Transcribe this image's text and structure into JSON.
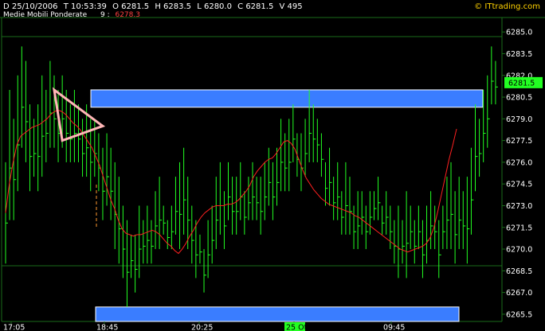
{
  "header": {
    "date": "D 25/10/2006",
    "time": "T 10:53:39",
    "open": "O 6281.5",
    "high": "H 6283.5",
    "low": "L 6280.0",
    "close": "C 6281.5",
    "volume": "V 495",
    "indicator_name": "Medie Mobili Ponderate",
    "indicator_period": "9 :",
    "indicator_value": "6278.3",
    "brand": "© ITtrading.com"
  },
  "colors": {
    "background": "#000000",
    "bars": "#22ff22",
    "moving_average": "#ff2020",
    "zones": "#3a7dff",
    "zone_border": "#ffffff",
    "triangle": "#ffb6b6",
    "grid": "#1a6b1a",
    "price_tag": "#22ff22",
    "indicator": "#ff4040",
    "brand": "#ffd200"
  },
  "chart_data": {
    "type": "bar",
    "subtype": "ohlc",
    "ylim": [
      6265.0,
      6286.0
    ],
    "y_ticks": [
      "6285.0",
      "6283.5",
      "6282.0",
      "6280.5",
      "6279.0",
      "6277.5",
      "6276.0",
      "6274.5",
      "6273.0",
      "6271.5",
      "6270.0",
      "6268.5",
      "6267.0",
      "6265.5"
    ],
    "x_ticks": [
      "17:05",
      "18:45",
      "20:25",
      "25 Ott",
      "09:45"
    ],
    "current_price": "6281.5",
    "bars": [
      [
        6276,
        6269
      ],
      [
        6281,
        6272
      ],
      [
        6279,
        6272
      ],
      [
        6282,
        6274
      ],
      [
        6284,
        6277
      ],
      [
        6283,
        6276
      ],
      [
        6280,
        6274
      ],
      [
        6279,
        6275
      ],
      [
        6280,
        6274
      ],
      [
        6282,
        6275
      ],
      [
        6281,
        6276
      ],
      [
        6283,
        6277
      ],
      [
        6282,
        6277
      ],
      [
        6281,
        6276
      ],
      [
        6282,
        6277
      ],
      [
        6281,
        6276
      ],
      [
        6280,
        6276
      ],
      [
        6281,
        6276
      ],
      [
        6280,
        6276
      ],
      [
        6279,
        6275
      ],
      [
        6280,
        6275
      ],
      [
        6279,
        6274
      ],
      [
        6279,
        6275
      ],
      [
        6278,
        6274
      ],
      [
        6277,
        6272
      ],
      [
        6278,
        6273
      ],
      [
        6277,
        6272
      ],
      [
        6276,
        6270
      ],
      [
        6275,
        6269
      ],
      [
        6273,
        6268
      ],
      [
        6272,
        6266
      ],
      [
        6271,
        6268
      ],
      [
        6271,
        6267
      ],
      [
        6273,
        6268
      ],
      [
        6272,
        6269
      ],
      [
        6273,
        6269
      ],
      [
        6272,
        6269
      ],
      [
        6274,
        6270
      ],
      [
        6275,
        6270
      ],
      [
        6273,
        6271
      ],
      [
        6272,
        6270
      ],
      [
        6273,
        6270
      ],
      [
        6275,
        6271
      ],
      [
        6276,
        6270
      ],
      [
        6277,
        6271
      ],
      [
        6275,
        6270
      ],
      [
        6273,
        6269
      ],
      [
        6272,
        6268
      ],
      [
        6271,
        6269
      ],
      [
        6270,
        6267
      ],
      [
        6272,
        6268
      ],
      [
        6273,
        6269
      ],
      [
        6275,
        6270
      ],
      [
        6276,
        6271
      ],
      [
        6274,
        6270
      ],
      [
        6276,
        6272
      ],
      [
        6275,
        6271
      ],
      [
        6275,
        6271
      ],
      [
        6276,
        6272
      ],
      [
        6274,
        6271
      ],
      [
        6275,
        6272
      ],
      [
        6276,
        6272
      ],
      [
        6275,
        6272
      ],
      [
        6275,
        6271
      ],
      [
        6276,
        6272
      ],
      [
        6277,
        6273
      ],
      [
        6276,
        6272
      ],
      [
        6277,
        6273
      ],
      [
        6279,
        6274
      ],
      [
        6278,
        6274
      ],
      [
        6279,
        6274
      ],
      [
        6280,
        6276
      ],
      [
        6278,
        6275
      ],
      [
        6278,
        6274
      ],
      [
        6279,
        6275
      ],
      [
        6281,
        6276
      ],
      [
        6280,
        6276
      ],
      [
        6279,
        6276
      ],
      [
        6278,
        6275
      ],
      [
        6276,
        6273
      ],
      [
        6277,
        6273
      ],
      [
        6275,
        6272
      ],
      [
        6276,
        6272
      ],
      [
        6274,
        6271
      ],
      [
        6276,
        6271
      ],
      [
        6275,
        6271
      ],
      [
        6273,
        6270
      ],
      [
        6274,
        6270
      ],
      [
        6274,
        6271
      ],
      [
        6273,
        6270
      ],
      [
        6274,
        6271
      ],
      [
        6274,
        6272
      ],
      [
        6275,
        6272
      ],
      [
        6273,
        6271
      ],
      [
        6274,
        6271
      ],
      [
        6273,
        6270
      ],
      [
        6272,
        6269
      ],
      [
        6273,
        6268
      ],
      [
        6272,
        6269
      ],
      [
        6274,
        6268
      ],
      [
        6273,
        6270
      ],
      [
        6272,
        6269
      ],
      [
        6273,
        6270
      ],
      [
        6272,
        6268
      ],
      [
        6273,
        6269
      ],
      [
        6274,
        6270
      ],
      [
        6273,
        6270
      ],
      [
        6272,
        6268
      ],
      [
        6273,
        6270
      ],
      [
        6275,
        6270
      ],
      [
        6276,
        6270
      ],
      [
        6274,
        6269
      ],
      [
        6275,
        6270
      ],
      [
        6274,
        6270
      ],
      [
        6275,
        6269
      ],
      [
        6277,
        6271
      ],
      [
        6280,
        6274
      ],
      [
        6279,
        6275
      ],
      [
        6281,
        6276
      ],
      [
        6282,
        6277
      ],
      [
        6284,
        6280
      ],
      [
        6283,
        6280
      ]
    ],
    "moving_average": [
      6272.5,
      6274.5,
      6276.0,
      6277.2,
      6277.8,
      6278.0,
      6278.2,
      6278.4,
      6278.5,
      6278.6,
      6278.8,
      6279.0,
      6279.3,
      6279.5,
      6279.6,
      6279.5,
      6279.3,
      6279.0,
      6278.7,
      6278.5,
      6278.2,
      6277.8,
      6277.4,
      6277.0,
      6276.4,
      6275.8,
      6275.0,
      6274.2,
      6273.4,
      6272.8,
      6272.0,
      6271.4,
      6271.1,
      6271.0,
      6270.9,
      6271.0,
      6271.0,
      6271.1,
      6271.2,
      6271.3,
      6271.2,
      6271.0,
      6270.7,
      6270.4,
      6270.2,
      6269.9,
      6269.7,
      6270.0,
      6270.4,
      6270.9,
      6271.3,
      6271.8,
      6272.2,
      6272.5,
      6272.7,
      6272.9,
      6273.0,
      6273.0,
      6273.0,
      6273.1,
      6273.1,
      6273.2,
      6273.4,
      6273.7,
      6274.0,
      6274.4,
      6275.0,
      6275.4,
      6275.7,
      6276.0,
      6276.2,
      6276.3,
      6276.6,
      6277.0,
      6277.4,
      6277.5,
      6277.3,
      6276.9,
      6276.2,
      6275.5,
      6274.9,
      6274.5,
      6274.1,
      6273.8,
      6273.5,
      6273.3,
      6273.1,
      6273.0,
      6272.9,
      6272.8,
      6272.7,
      6272.6,
      6272.5,
      6272.3,
      6272.2,
      6272.0,
      6271.8,
      6271.6,
      6271.4,
      6271.2,
      6271.0,
      6270.8,
      6270.6,
      6270.4,
      6270.2,
      6270.0,
      6269.9,
      6269.8,
      6269.9,
      6270.0,
      6270.1,
      6270.2,
      6270.4,
      6270.8,
      6271.5,
      6272.6,
      6273.8,
      6275.0,
      6276.2,
      6277.2,
      6278.3
    ],
    "zones": [
      {
        "name": "resistance-zone",
        "from": 6279.8,
        "to": 6281.0
      },
      {
        "name": "support-zone",
        "from": 6265.0,
        "to": 6266.0
      }
    ],
    "triangle": {
      "points": [
        [
          12,
          6281.0
        ],
        [
          24,
          6278.5
        ],
        [
          14,
          6277.5
        ]
      ]
    }
  }
}
